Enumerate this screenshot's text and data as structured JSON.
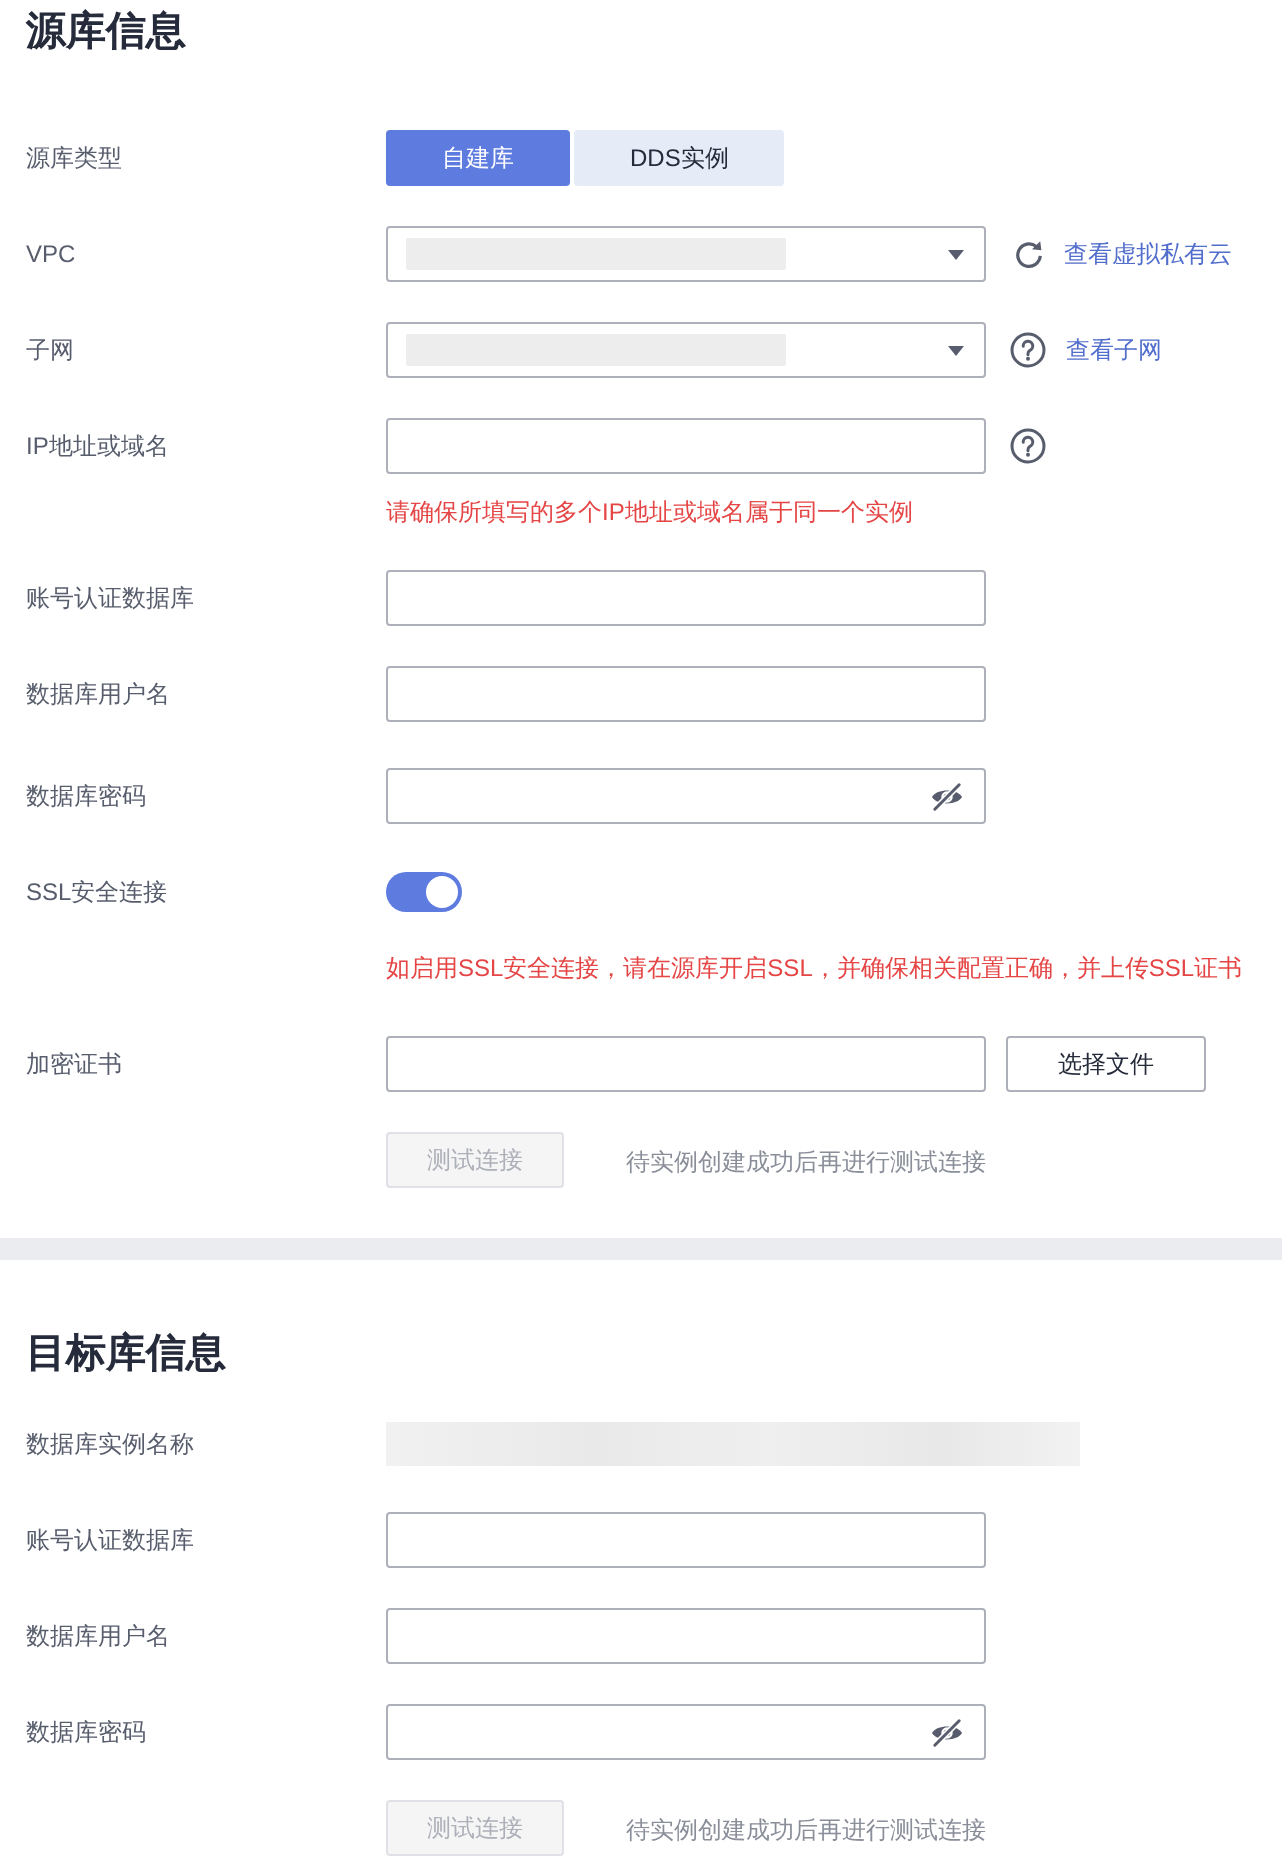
{
  "source": {
    "title": "源库信息",
    "fields": [
      {
        "kind": "segmented",
        "label": "源库类型",
        "options": [
          {
            "label": "自建库",
            "selected": true
          },
          {
            "label": "DDS实例",
            "selected": false
          }
        ]
      },
      {
        "kind": "select",
        "label": "VPC",
        "action": {
          "kind": "refresh",
          "link": "查看虚拟私有云"
        }
      },
      {
        "kind": "select",
        "label": "子网",
        "action": {
          "kind": "help",
          "link": "查看子网"
        }
      },
      {
        "kind": "text",
        "label": "IP地址或域名",
        "action": {
          "kind": "help"
        },
        "hint": "请确保所填写的多个IP地址或域名属于同一个实例"
      },
      {
        "kind": "text",
        "label": "账号认证数据库"
      },
      {
        "kind": "text",
        "label": "数据库用户名"
      },
      {
        "kind": "password",
        "label": "数据库密码"
      },
      {
        "kind": "switch",
        "label": "SSL安全连接",
        "on": true,
        "hint": "如启用SSL安全连接，请在源库开启SSL，并确保相关配置正确，并上传SSL证书"
      },
      {
        "kind": "file",
        "label": "加密证书",
        "button": "选择文件"
      }
    ],
    "test": {
      "button": "测试连接",
      "disabled": true,
      "note": "待实例创建成功后再进行测试连接"
    }
  },
  "target": {
    "title": "目标库信息",
    "fields": [
      {
        "kind": "readonly",
        "label": "数据库实例名称"
      },
      {
        "kind": "text",
        "label": "账号认证数据库"
      },
      {
        "kind": "text",
        "label": "数据库用户名"
      },
      {
        "kind": "password",
        "label": "数据库密码"
      }
    ],
    "test": {
      "button": "测试连接",
      "disabled": true,
      "note": "待实例创建成功后再进行测试连接"
    }
  }
}
